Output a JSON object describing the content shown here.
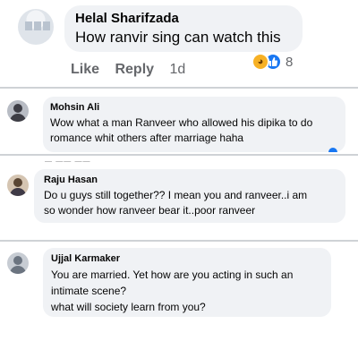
{
  "comments": [
    {
      "author": "Helal Sharifzada",
      "text": "How ranvir sing can watch this",
      "actions": {
        "like": "Like",
        "reply": "Reply",
        "time": "1d"
      },
      "reactions": {
        "icons": [
          "haha-icon",
          "like-icon"
        ],
        "count": "8"
      }
    },
    {
      "author": "Mohsin Ali",
      "lines": [
        "Wow what a man Ranveer who allowed his dipika to do",
        "romance whit others after marriage haha"
      ]
    },
    {
      "author": "Raju Hasan",
      "lines": [
        "Do u guys still together?? I mean you and ranveer..i am",
        "so wonder how ranveer bear it..poor ranveer"
      ]
    },
    {
      "author": "Ujjal Karmaker",
      "lines": [
        "You are married. Yet how are you acting in such an",
        "intimate scene?",
        "what will society learn from you?"
      ]
    }
  ],
  "colors": {
    "bubble": "#f0f2f5",
    "secondary_text": "#65676b",
    "like_blue": "#1877f2",
    "haha_yellow": "#f7b125"
  }
}
